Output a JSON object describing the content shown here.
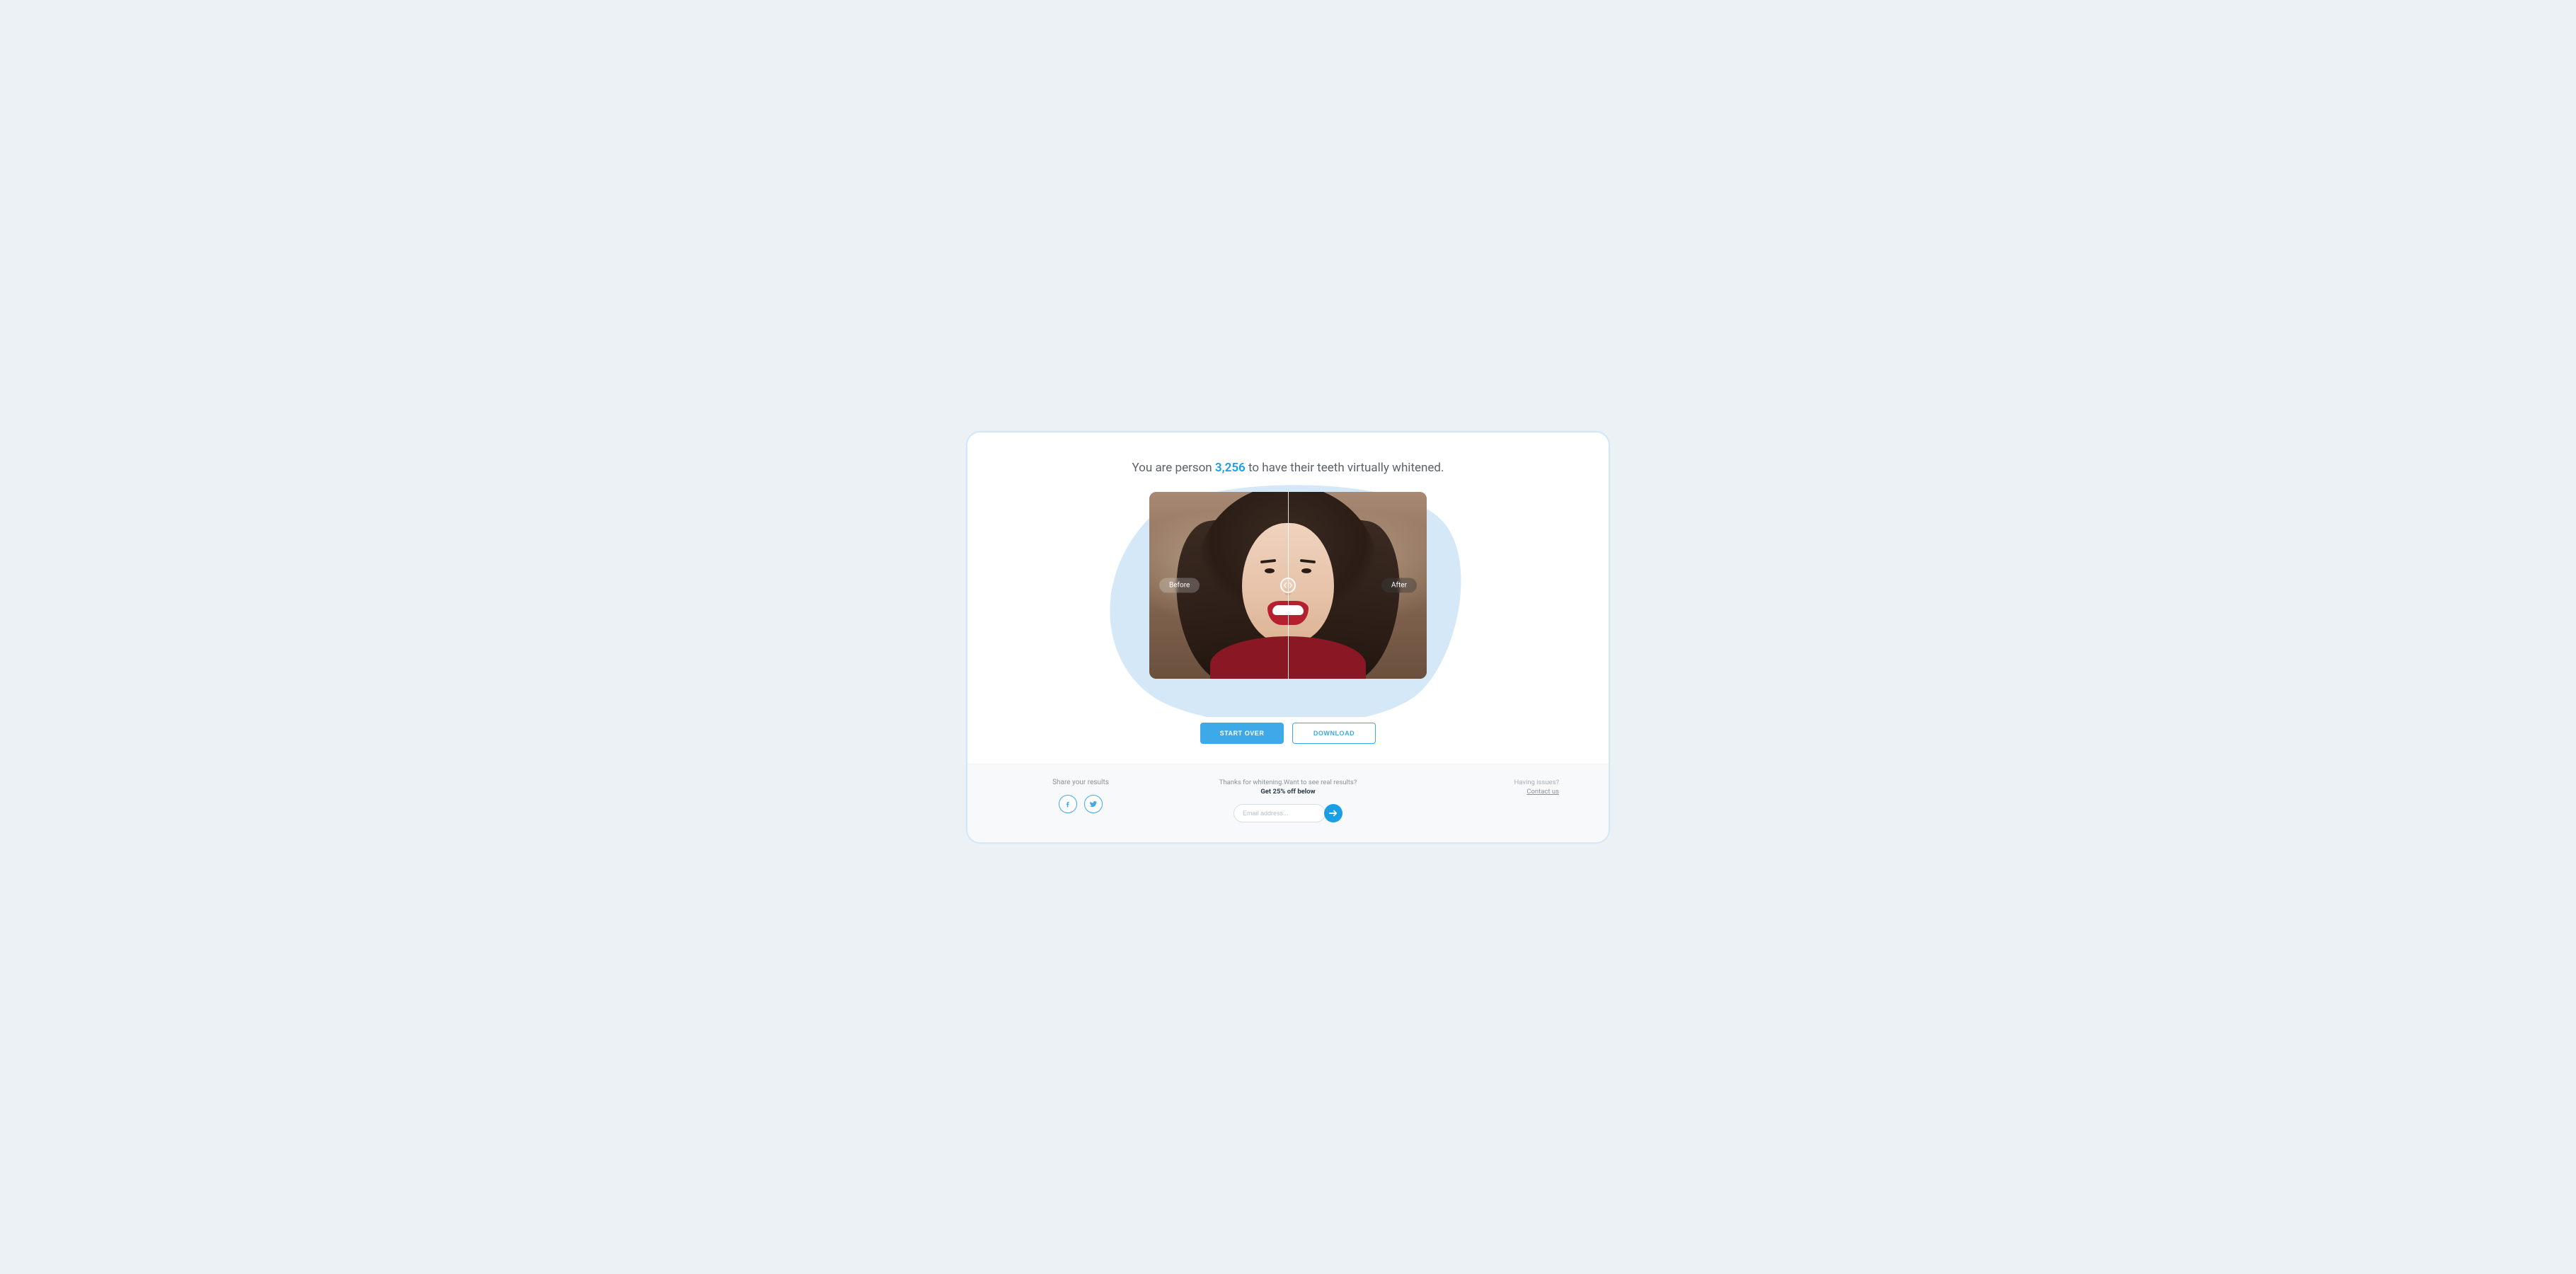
{
  "headline": {
    "prefix": "You are person ",
    "count": "3,256",
    "suffix": " to have their teeth virtually whitened."
  },
  "compare": {
    "before_label": "Before",
    "after_label": "After"
  },
  "actions": {
    "start_over": "START OVER",
    "download": "DOWNLOAD"
  },
  "footer": {
    "share": {
      "title": "Share your results"
    },
    "promo": {
      "line1": "Thanks for whitening.Want to see real results?",
      "line2": "Get 25% off below",
      "email_placeholder": "Email address..."
    },
    "issues": {
      "title": "Having issues?",
      "link": "Contact us"
    }
  }
}
